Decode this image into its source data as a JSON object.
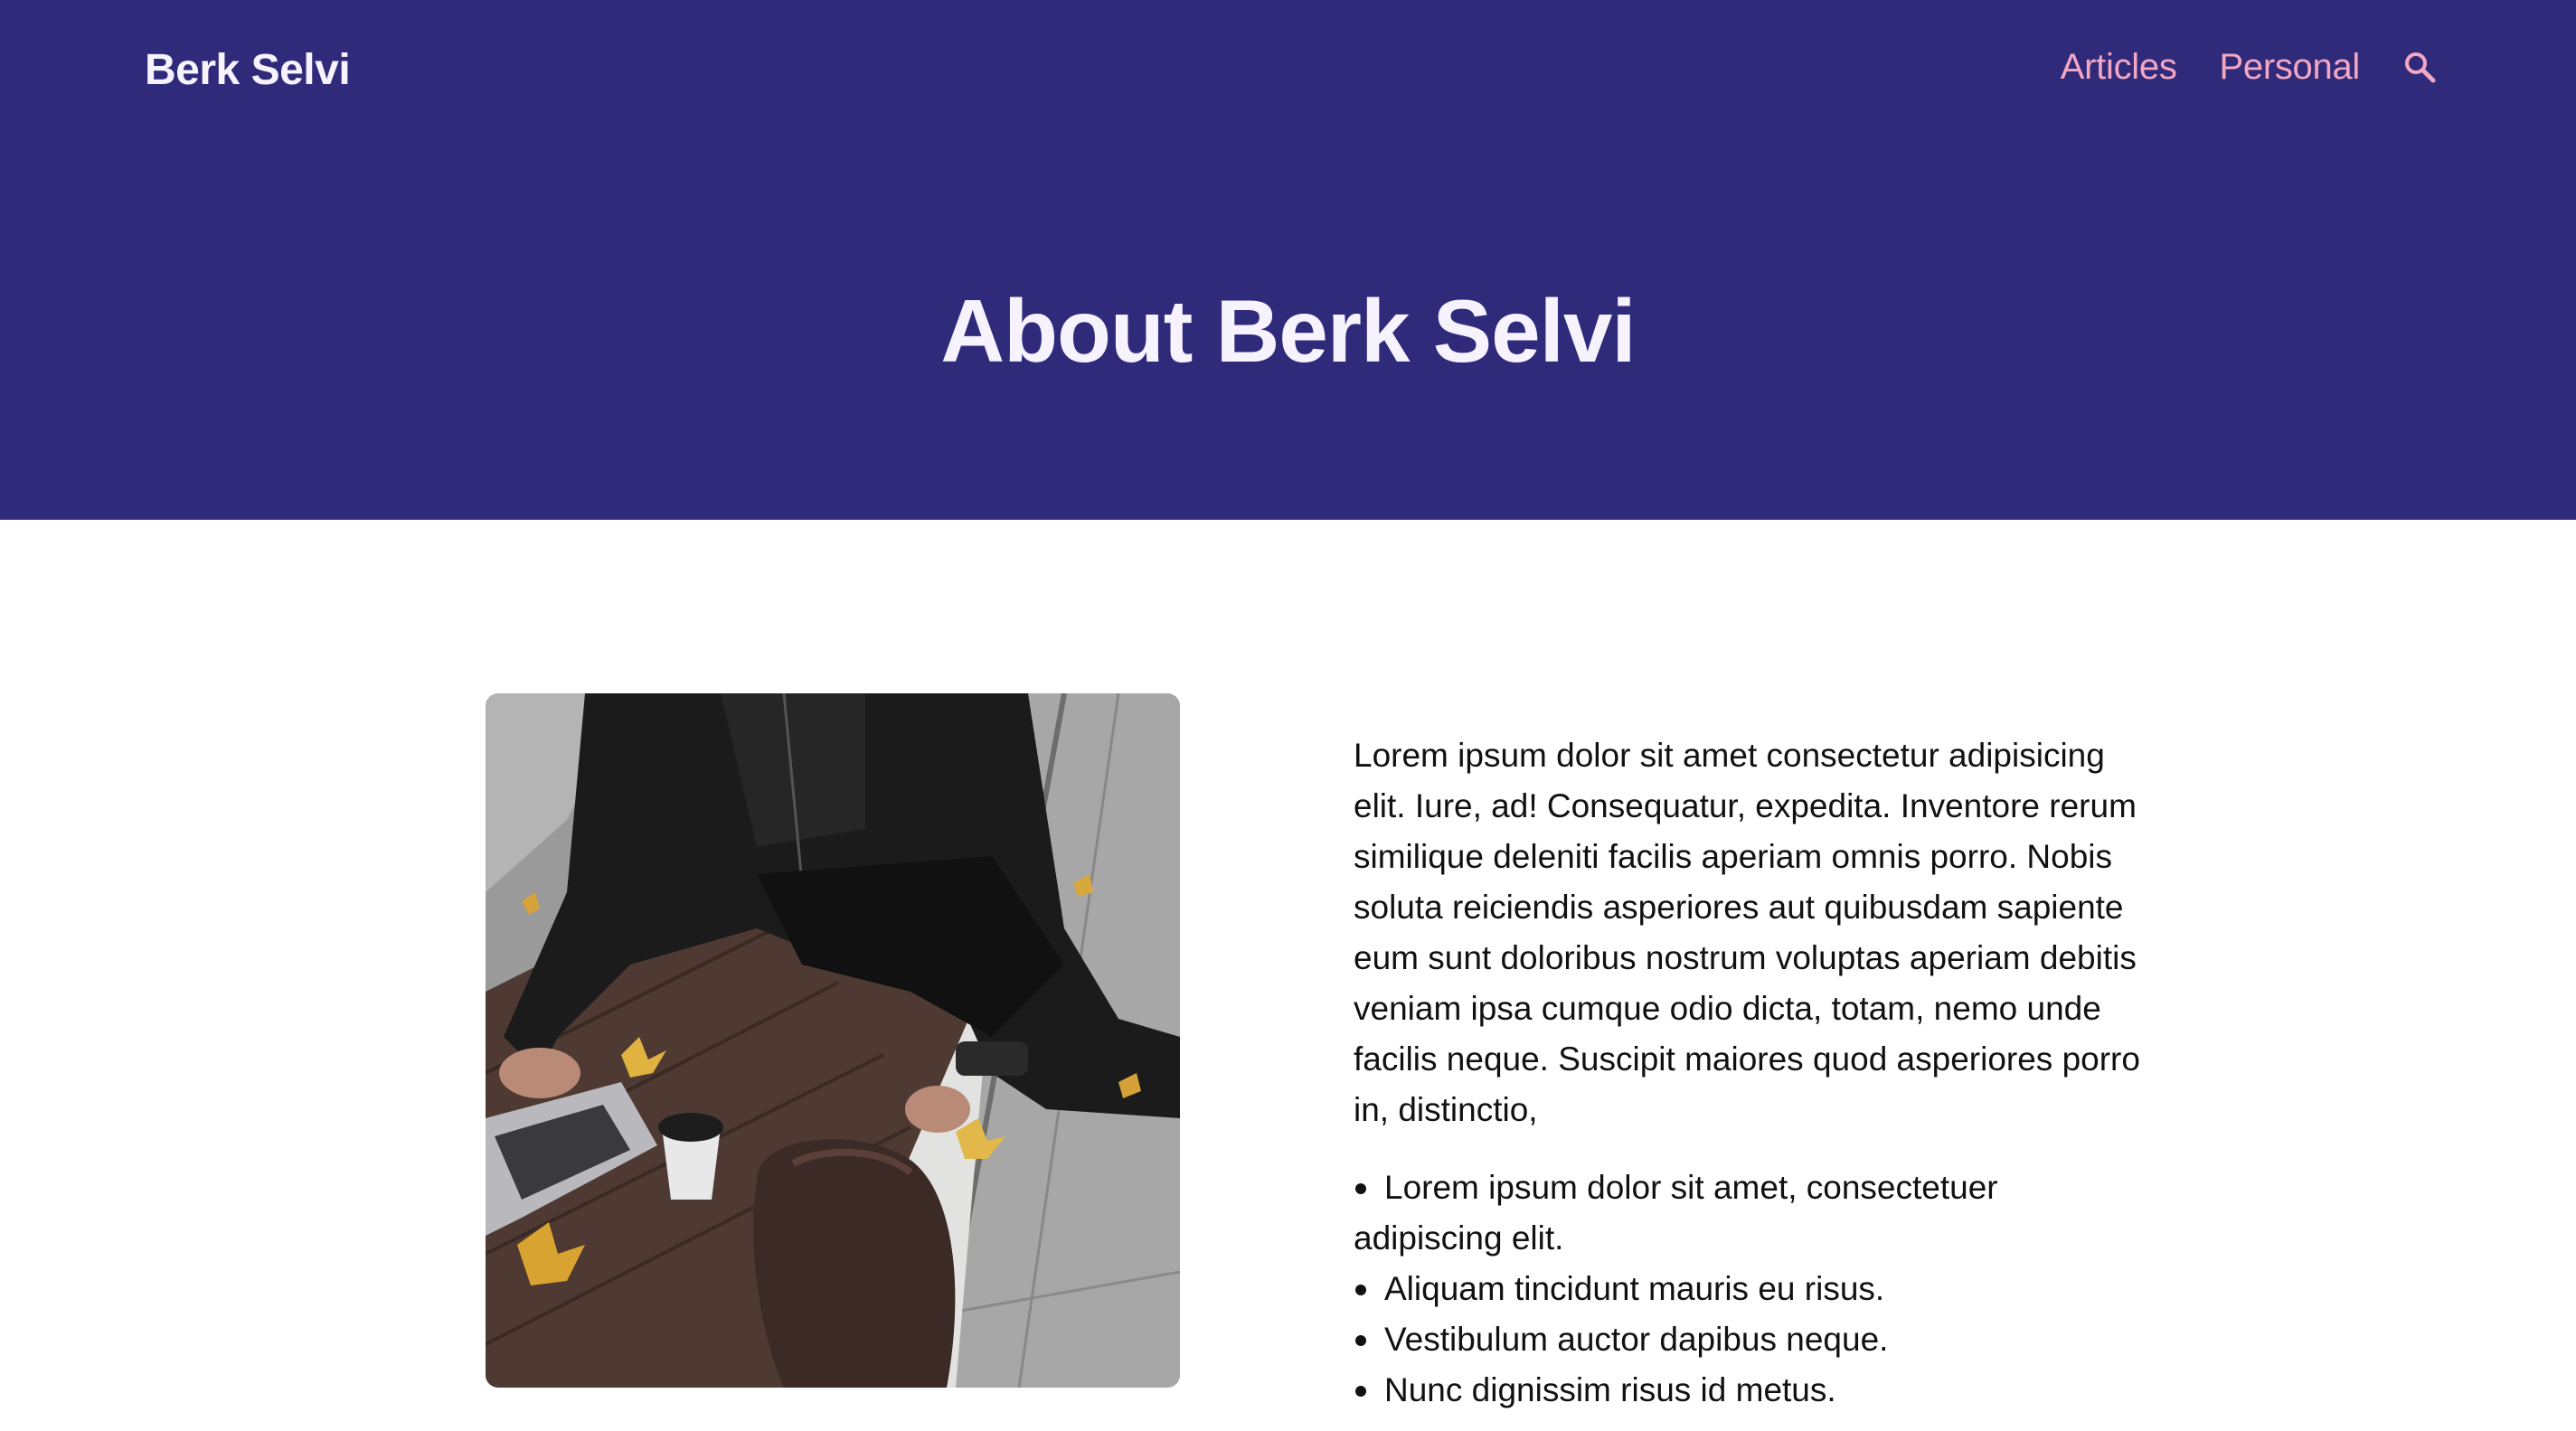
{
  "theme": {
    "hero_bg": "#302a7b",
    "nav_link_color": "#f3a7c2",
    "title_color": "#f6f3ff"
  },
  "header": {
    "brand": "Berk Selvi",
    "nav": [
      {
        "label": "Articles"
      },
      {
        "label": "Personal"
      }
    ],
    "search_icon": "search-icon"
  },
  "hero": {
    "title": "About Berk Selvi"
  },
  "about": {
    "image_alt": "person with leather jacket using a laptop on a wooden bench with coffee cup and backpack",
    "paragraph": "Lorem ipsum dolor sit amet consectetur adipisicing elit. Iure, ad! Consequatur, expedita. Inventore rerum similique deleniti facilis aperiam omnis porro. Nobis soluta reiciendis asperiores aut quibusdam sapiente eum sunt doloribus nostrum voluptas aperiam debitis veniam ipsa cumque odio dicta, totam, nemo unde facilis neque. Suscipit maiores quod asperiores porro in, distinctio,",
    "list": [
      "Lorem ipsum dolor sit amet, consectetuer adipiscing elit.",
      "Aliquam tincidunt mauris eu risus.",
      "Vestibulum auctor dapibus neque.",
      "Nunc dignissim risus id metus."
    ]
  }
}
